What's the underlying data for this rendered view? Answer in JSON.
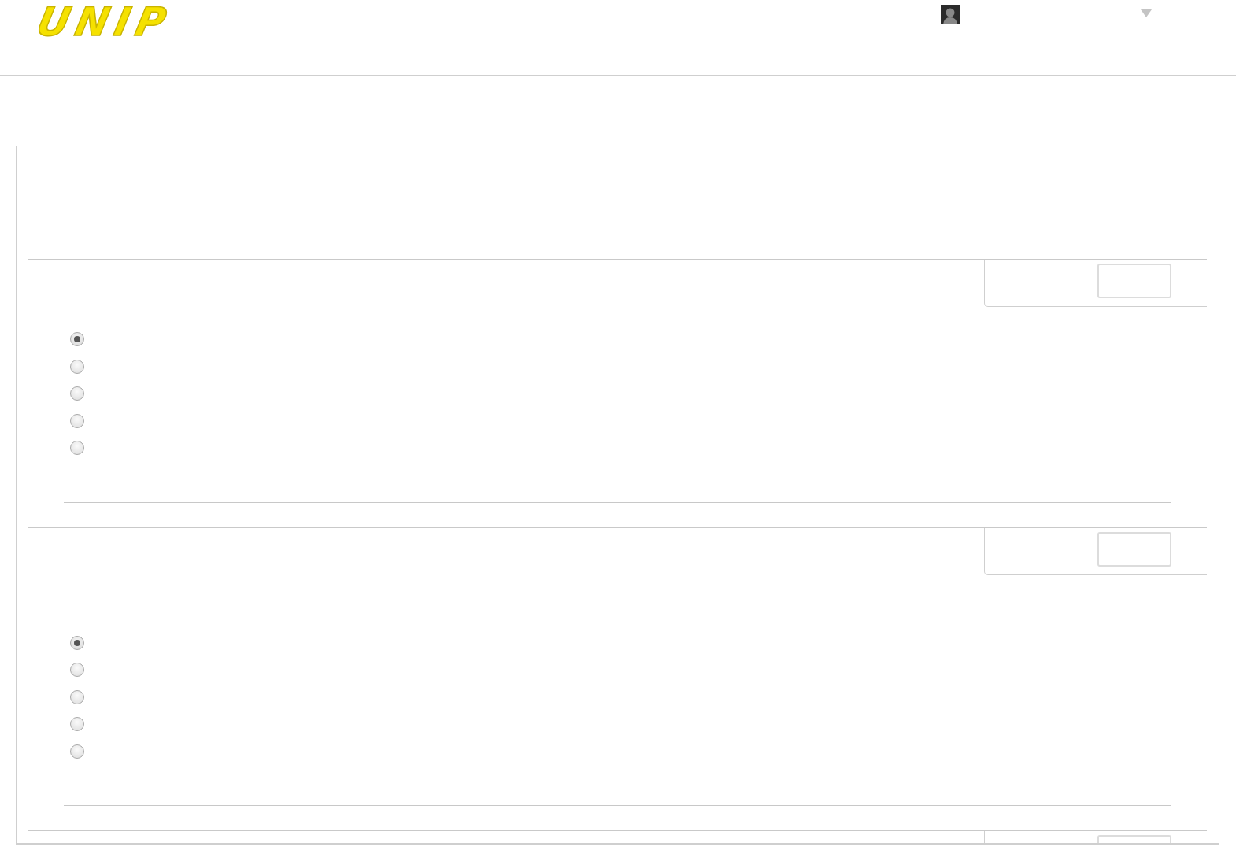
{
  "header": {
    "logo": "UNIP"
  },
  "questions": [
    {
      "kind": "full",
      "options": [
        {
          "selected": true
        },
        {
          "selected": false
        },
        {
          "selected": false
        },
        {
          "selected": false
        },
        {
          "selected": false
        }
      ]
    },
    {
      "kind": "full",
      "options": [
        {
          "selected": true
        },
        {
          "selected": false
        },
        {
          "selected": false
        },
        {
          "selected": false
        },
        {
          "selected": false
        }
      ]
    },
    {
      "kind": "cut"
    }
  ]
}
